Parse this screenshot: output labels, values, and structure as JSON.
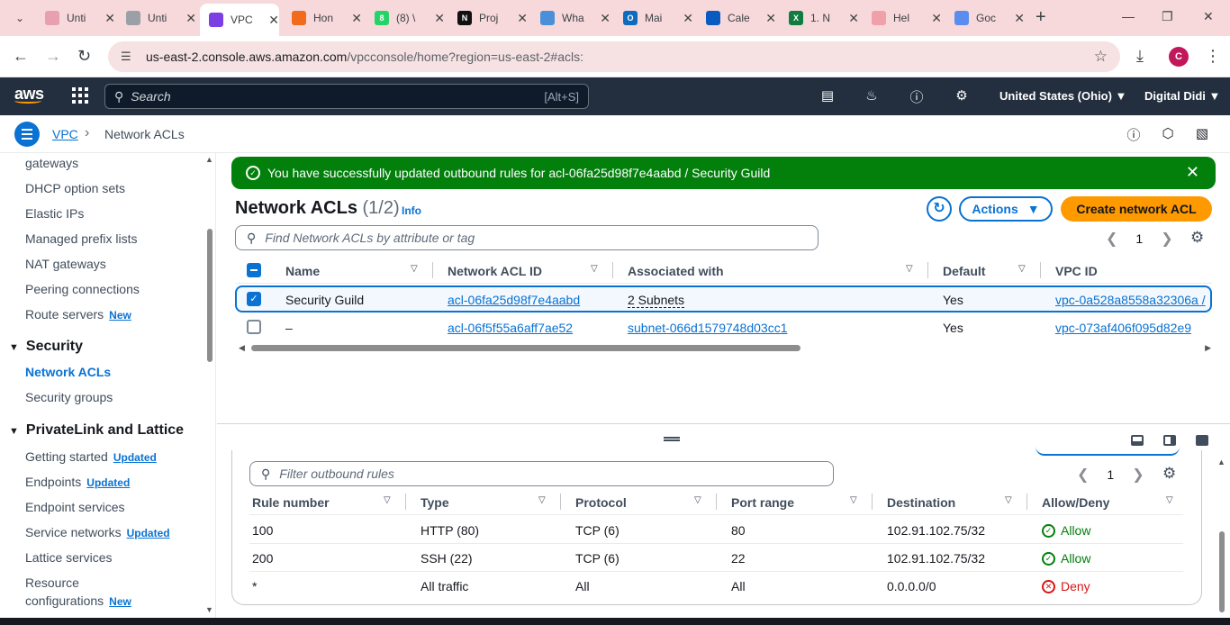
{
  "browser": {
    "tabs": [
      {
        "label": "Unti",
        "color": "#e8a0b0",
        "glyph": ""
      },
      {
        "label": "Unti",
        "color": "#9aa0a6",
        "glyph": ""
      },
      {
        "label": "VPC",
        "color": "#7b3fe4",
        "glyph": ""
      },
      {
        "label": "Hon",
        "color": "#f26b1d",
        "glyph": ""
      },
      {
        "label": "(8) \\",
        "color": "#25d366",
        "glyph": "8"
      },
      {
        "label": "Proj",
        "color": "#111111",
        "glyph": "N"
      },
      {
        "label": "Wha",
        "color": "#4a90d9",
        "glyph": ""
      },
      {
        "label": "Mai",
        "color": "#0f6cbd",
        "glyph": "O"
      },
      {
        "label": "Cale",
        "color": "#0a5bbf",
        "glyph": ""
      },
      {
        "label": "1. N",
        "color": "#107c41",
        "glyph": "X"
      },
      {
        "label": "Hel",
        "color": "#f0a0a8",
        "glyph": ""
      },
      {
        "label": "Goc",
        "color": "#5b8def",
        "glyph": ""
      }
    ],
    "url_domain": "us-east-2.console.aws.amazon.com",
    "url_path": "/vpcconsole/home?region=us-east-2#acls:",
    "profile_initial": "C"
  },
  "aws": {
    "logo": "aws",
    "search_placeholder": "Search",
    "search_shortcut": "[Alt+S]",
    "region": "United States (Ohio) ▼",
    "account": "Digital Didi ▼"
  },
  "breadcrumb": {
    "service": "VPC",
    "current": "Network ACLs"
  },
  "sidenav": {
    "items_top": [
      {
        "label": "gateways",
        "badge": ""
      },
      {
        "label": "DHCP option sets",
        "badge": ""
      },
      {
        "label": "Elastic IPs",
        "badge": ""
      },
      {
        "label": "Managed prefix lists",
        "badge": ""
      },
      {
        "label": "NAT gateways",
        "badge": ""
      },
      {
        "label": "Peering connections",
        "badge": ""
      },
      {
        "label": "Route servers",
        "badge": "New"
      }
    ],
    "security_title": "Security",
    "security_items": [
      {
        "label": "Network ACLs",
        "badge": ""
      },
      {
        "label": "Security groups",
        "badge": ""
      }
    ],
    "privatelink_title": "PrivateLink and Lattice",
    "privatelink_items": [
      {
        "label": "Getting started",
        "badge": "Updated"
      },
      {
        "label": "Endpoints",
        "badge": "Updated"
      },
      {
        "label": "Endpoint services",
        "badge": ""
      },
      {
        "label": "Service networks",
        "badge": "Updated"
      },
      {
        "label": "Lattice services",
        "badge": ""
      },
      {
        "label": "Resource",
        "badge": ""
      },
      {
        "label": "configurations",
        "badge": "New"
      }
    ]
  },
  "flash": {
    "message": "You have successfully updated outbound rules for acl-06fa25d98f7e4aabd / Security Guild"
  },
  "acls": {
    "title": "Network ACLs",
    "count": "(1/2)",
    "info": "Info",
    "actions_label": "Actions",
    "create_label": "Create network ACL",
    "filter_placeholder": "Find Network ACLs by attribute or tag",
    "page": "1",
    "columns": [
      "Name",
      "Network ACL ID",
      "Associated with",
      "Default",
      "VPC ID"
    ],
    "rows": [
      {
        "name": "Security Guild",
        "id": "acl-06fa25d98f7e4aabd",
        "assoc": "2 Subnets",
        "default": "Yes",
        "vpc": "vpc-0a528a8558a32306a /",
        "selected": true
      },
      {
        "name": "–",
        "id": "acl-06f5f55a6aff7ae52",
        "assoc": "subnet-066d1579748d03cc1",
        "default": "Yes",
        "vpc": "vpc-073af406f095d82e9",
        "selected": false
      }
    ]
  },
  "outbound": {
    "filter_placeholder": "Filter outbound rules",
    "page": "1",
    "columns": [
      "Rule number",
      "Type",
      "Protocol",
      "Port range",
      "Destination",
      "Allow/Deny"
    ],
    "rows": [
      {
        "rule": "100",
        "type": "HTTP (80)",
        "protocol": "TCP (6)",
        "port": "80",
        "dest": "102.91.102.75/32",
        "action": "Allow"
      },
      {
        "rule": "200",
        "type": "SSH (22)",
        "protocol": "TCP (6)",
        "port": "22",
        "dest": "102.91.102.75/32",
        "action": "Allow"
      },
      {
        "rule": "*",
        "type": "All traffic",
        "protocol": "All",
        "port": "All",
        "dest": "0.0.0.0/0",
        "action": "Deny"
      }
    ]
  }
}
